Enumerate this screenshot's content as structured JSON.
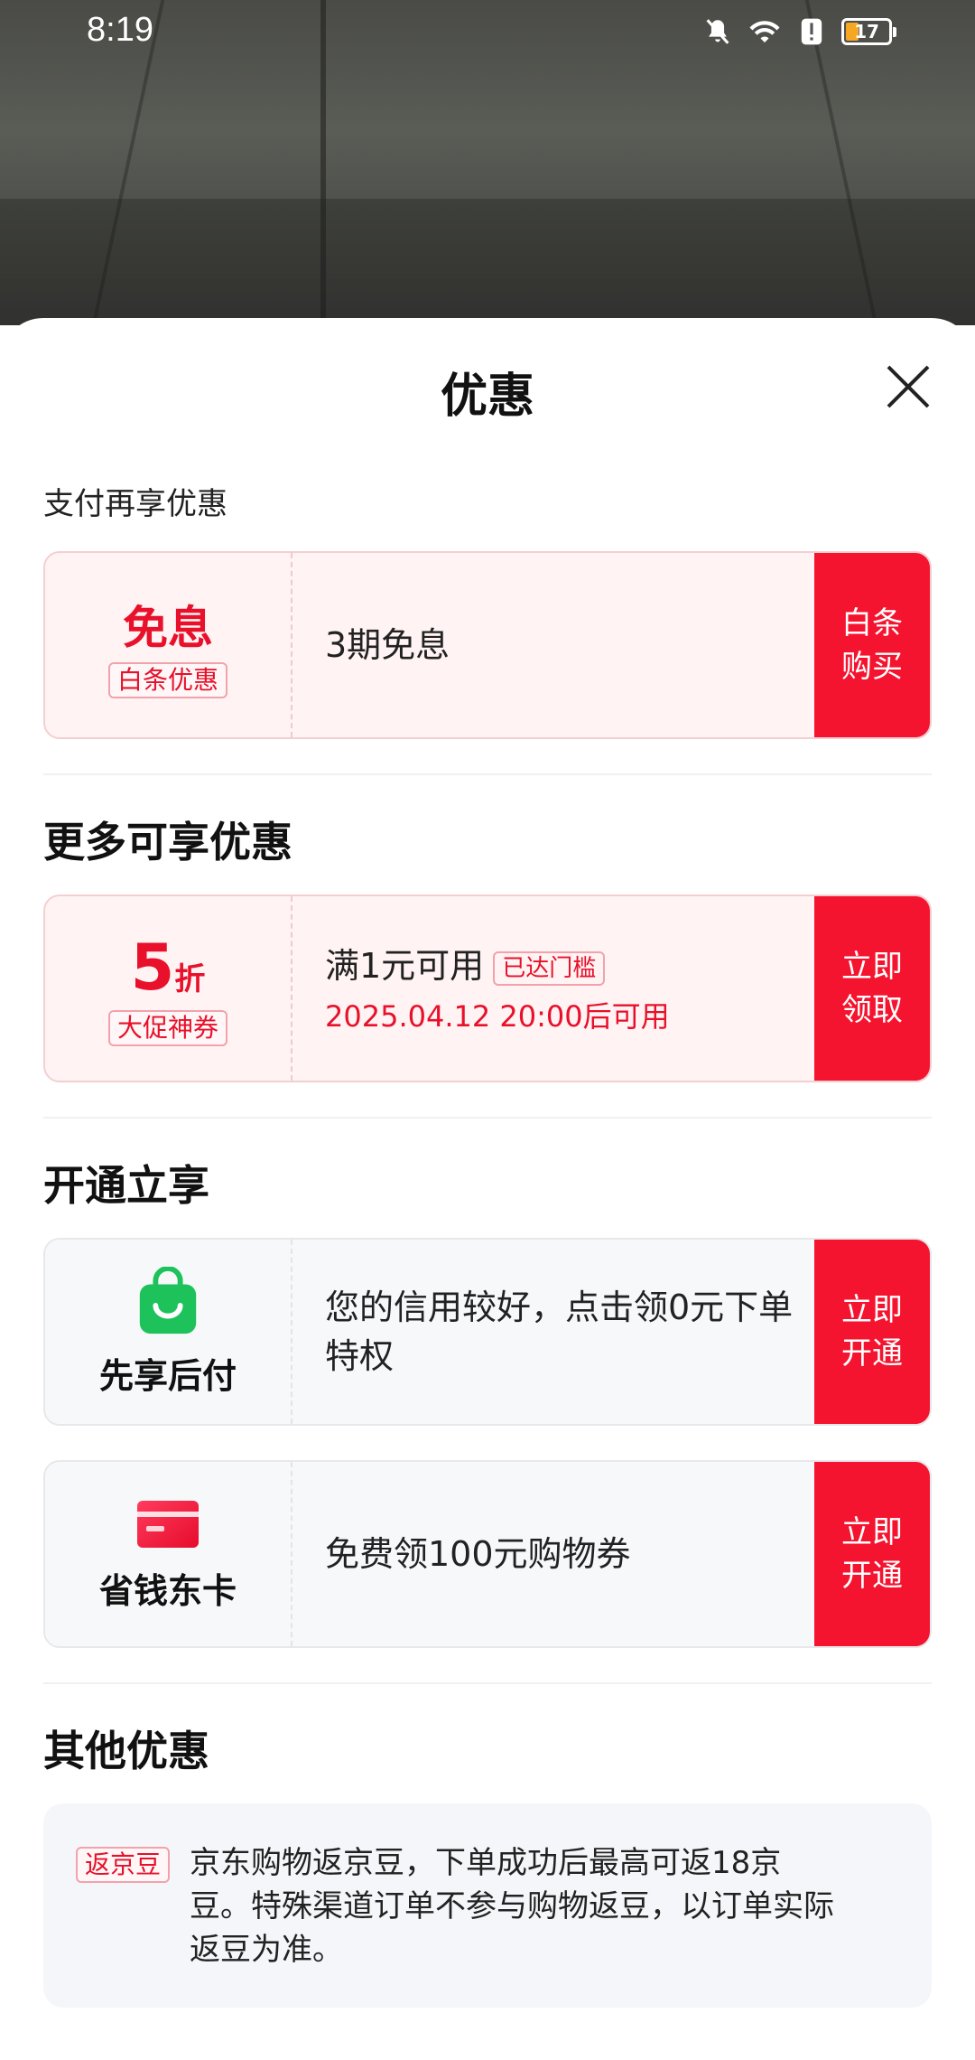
{
  "status_bar": {
    "time": "8:19",
    "battery": "17"
  },
  "sheet": {
    "title": "优惠"
  },
  "pay_section": {
    "label": "支付再享优惠",
    "card": {
      "badge": "免息",
      "tag": "白条优惠",
      "text": "3期免息",
      "button_line1": "白条",
      "button_line2": "购买"
    }
  },
  "more_section": {
    "heading": "更多可享优惠",
    "card": {
      "discount_num": "5",
      "discount_unit": "折",
      "tag": "大促神券",
      "text": "满1元可用",
      "status_tag": "已达门槛",
      "time_text": "2025.04.12 20:00后可用",
      "button_line1": "立即",
      "button_line2": "领取"
    }
  },
  "open_section": {
    "heading": "开通立享",
    "cards": [
      {
        "name": "先享后付",
        "icon": "shopping-bag-icon",
        "text": "您的信用较好，点击领0元下单特权",
        "button_line1": "立即",
        "button_line2": "开通"
      },
      {
        "name": "省钱东卡",
        "icon": "card-icon",
        "text": "免费领100元购物券",
        "button_line1": "立即",
        "button_line2": "开通"
      }
    ]
  },
  "other_section": {
    "heading": "其他优惠",
    "tag": "返京豆",
    "text": "京东购物返京豆，下单成功后最高可返18京豆。特殊渠道订单不参与购物返豆，以订单实际返豆为准。"
  },
  "colors": {
    "accent": "#f5142f",
    "card_bg": "#fff3f3",
    "gray_bg": "#f7f8fa"
  }
}
